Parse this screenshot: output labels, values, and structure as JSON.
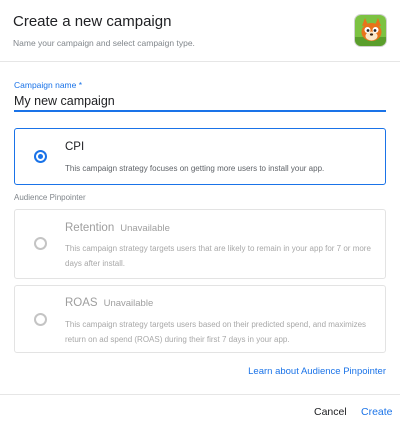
{
  "dialog": {
    "title": "Create a new campaign",
    "subtitle": "Name your campaign and select campaign type.",
    "app_icon": "app-logo-icon"
  },
  "campaign_name": {
    "label": "Campaign name *",
    "value": "My new campaign"
  },
  "options": [
    {
      "title": "CPI",
      "status": "",
      "description": "This campaign strategy focuses on getting more users to install your app.",
      "selected": true,
      "enabled": true
    },
    {
      "title": "Retention",
      "status": "Unavailable",
      "description": "This campaign strategy targets users that are likely to remain in your app for 7 or more days after install.",
      "selected": false,
      "enabled": false
    },
    {
      "title": "ROAS",
      "status": "Unavailable",
      "description": "This campaign strategy targets users based on their predicted spend, and maximizes return on ad spend (ROAS) during their first 7 days in your app.",
      "selected": false,
      "enabled": false
    }
  ],
  "section_label": "Audience Pinpointer",
  "learn_link": "Learn about Audience Pinpointer",
  "footer": {
    "cancel": "Cancel",
    "create": "Create"
  },
  "colors": {
    "accent": "#1a73e8",
    "disabled_text": "#9e9e9e",
    "border": "#e3e3e3"
  }
}
